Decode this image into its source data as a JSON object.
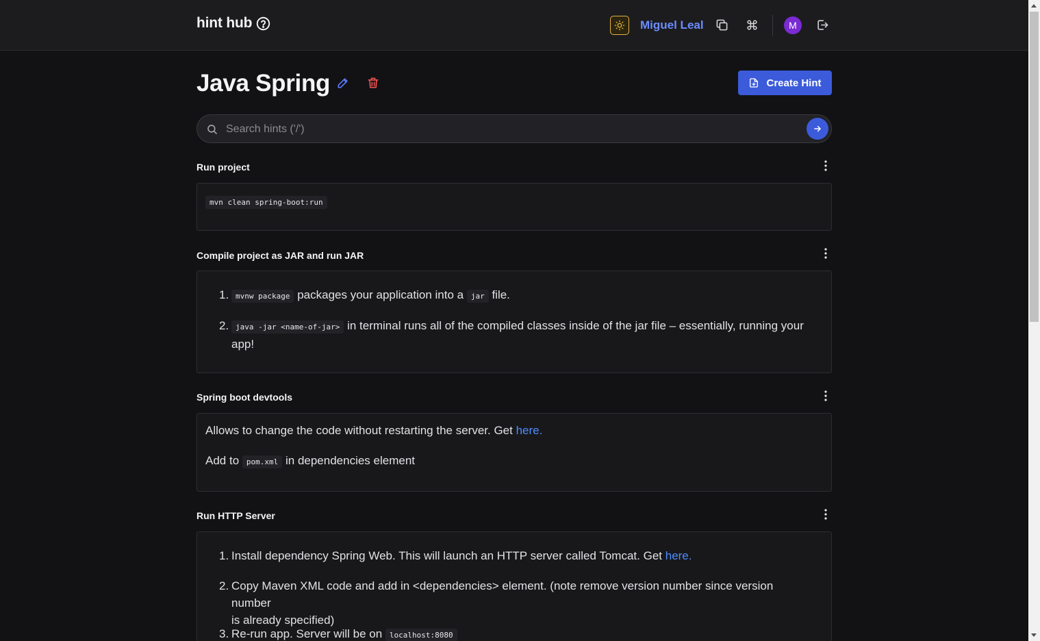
{
  "header": {
    "brand": "hint hub",
    "user_name": "Miguel Leal",
    "avatar_initial": "M"
  },
  "page": {
    "title": "Java Spring",
    "create_label": "Create Hint",
    "search_placeholder": "Search hints ('/')"
  },
  "hints": [
    {
      "title": "Run project",
      "code": "mvn clean spring-boot:run"
    },
    {
      "title": "Compile project as JAR and run JAR",
      "step1_num": "1.",
      "step1_code": "mvnw package",
      "step1_text": "packages your application into a",
      "step1_code2": "jar",
      "step1_tail": "file.",
      "step2_num": "2.",
      "step2_code": "java -jar <name-of-jar>",
      "step2_text": "in terminal runs all of the compiled classes inside of the jar file – essentially, running your",
      "step2_tail": "app!"
    },
    {
      "title": "Spring boot devtools",
      "line1": "Allows to change the code without restarting the server. Get",
      "line1_link": "here.",
      "line2_pre": "Add to",
      "line2_code": "pom.xml",
      "line2_post": "in dependencies element"
    },
    {
      "title": "Run HTTP Server",
      "step1_num": "1.",
      "step1_text": "Install dependency Spring Web. This will launch an HTTP server called Tomcat. Get",
      "step1_link": "here.",
      "step2_num": "2.",
      "step2_text": "Copy Maven XML code and add in <dependencies> element. (note remove version number since version number",
      "step2_tail": "is already specified)",
      "step3_num": "3.",
      "step3_text": "Re-run app. Server will be on",
      "step3_code": "localhost:8080"
    }
  ],
  "colors": {
    "accent": "#3b5bdb",
    "link": "#4c8dff",
    "user": "#6b8cff",
    "avatar": "#7a2bd1",
    "theme_border": "#e3b341"
  },
  "icons": {
    "brand": "question-circle-icon",
    "theme": "sun-icon",
    "copy": "copy-icon",
    "command": "command-icon",
    "logout": "logout-icon",
    "edit": "pencil-icon",
    "delete": "trash-icon",
    "create": "file-plus-icon",
    "search": "search-icon",
    "submit": "arrow-right-icon",
    "menu": "kebab-icon"
  }
}
